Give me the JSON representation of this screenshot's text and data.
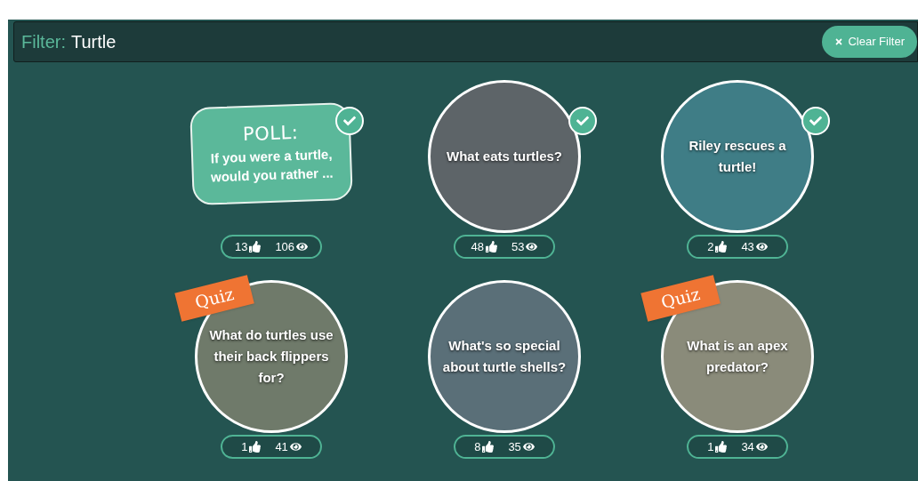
{
  "filter": {
    "label": "Filter:",
    "value": "Turtle",
    "clear_button": "Clear Filter"
  },
  "cards": [
    {
      "kind": "poll",
      "heading": "POLL:",
      "title": "If you were a turtle, would you rather ...",
      "completed": true,
      "likes": "13",
      "views": "106"
    },
    {
      "kind": "video",
      "title": "What eats turtles?",
      "completed": true,
      "likes": "48",
      "views": "53"
    },
    {
      "kind": "video",
      "title": "Riley rescues a turtle!",
      "completed": true,
      "likes": "2",
      "views": "43"
    },
    {
      "kind": "video",
      "badge": "Quiz",
      "title": "What do turtles use their back flippers for?",
      "completed": false,
      "likes": "1",
      "views": "41"
    },
    {
      "kind": "video",
      "title": "What's so special about turtle shells?",
      "completed": false,
      "likes": "8",
      "views": "35"
    },
    {
      "kind": "video",
      "badge": "Quiz",
      "title": "What is an apex predator?",
      "completed": false,
      "likes": "1",
      "views": "34"
    }
  ]
}
